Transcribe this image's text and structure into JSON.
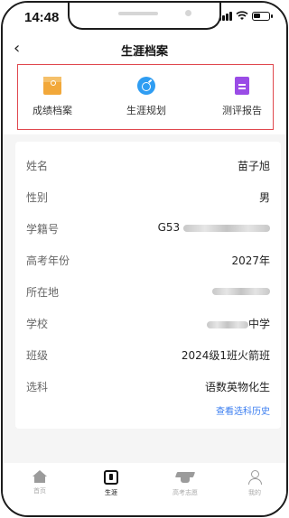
{
  "status_bar": {
    "time": "14:48"
  },
  "header": {
    "back_icon": "chevron-left-icon",
    "title": "生涯档案"
  },
  "features": [
    {
      "label": "成绩档案",
      "icon": "grade-folder-icon",
      "color": "#f2a83a"
    },
    {
      "label": "生涯规划",
      "icon": "compass-icon",
      "color": "#2f9df2"
    },
    {
      "label": "测评报告",
      "icon": "report-icon",
      "color": "#9a4ce6"
    }
  ],
  "profile": {
    "rows": [
      {
        "key": "姓名",
        "value": "苗子旭"
      },
      {
        "key": "性别",
        "value": "男"
      },
      {
        "key": "学籍号",
        "value": "G53"
      },
      {
        "key": "高考年份",
        "value": "2027年"
      },
      {
        "key": "所在地",
        "value": ""
      },
      {
        "key": "学校",
        "value": "中学"
      },
      {
        "key": "班级",
        "value": "2024级1班火箭班"
      },
      {
        "key": "选科",
        "value": "语数英物化生"
      }
    ],
    "history_link": "查看选科历史"
  },
  "tabbar": {
    "items": [
      {
        "label": "首页",
        "icon": "home-icon",
        "active": false
      },
      {
        "label": "生涯",
        "icon": "career-icon",
        "active": true
      },
      {
        "label": "高考志愿",
        "icon": "graduation-cap-icon",
        "active": false
      },
      {
        "label": "我的",
        "icon": "person-icon",
        "active": false
      }
    ]
  },
  "colors": {
    "highlight_border": "#e0484e",
    "link": "#3a7df0"
  }
}
